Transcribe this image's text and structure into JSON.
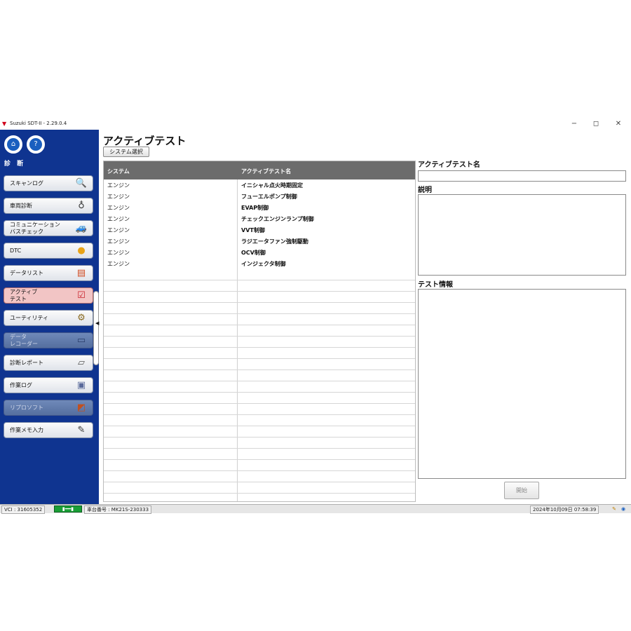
{
  "window": {
    "title": "Suzuki SDT-II - 2.29.0.4",
    "controls": {
      "minimize": "−",
      "restore": "◻",
      "close": "✕"
    }
  },
  "sidebar": {
    "home_icon": "home-icon",
    "help_icon": "help-icon",
    "section_title": "診 断",
    "items": [
      {
        "label": "スキャンログ",
        "icon": "magnifier-icon",
        "glyph": "🔍",
        "state": "normal"
      },
      {
        "label": "車両診断",
        "icon": "stethoscope-icon",
        "glyph": "♁",
        "state": "normal"
      },
      {
        "label": "コミュニケーション\nバスチェック",
        "icon": "car-icon",
        "glyph": "🚙",
        "state": "normal"
      },
      {
        "label": "DTC",
        "icon": "engine-light-icon",
        "glyph": "●",
        "state": "normal"
      },
      {
        "label": "データリスト",
        "icon": "data-book-icon",
        "glyph": "▤",
        "state": "normal"
      },
      {
        "label": "アクティブ\nテスト",
        "icon": "checklist-icon",
        "glyph": "☑",
        "state": "active"
      },
      {
        "label": "ユーティリティ",
        "icon": "gear-icon",
        "glyph": "⚙",
        "state": "normal"
      },
      {
        "label": "データ\nレコーダー",
        "icon": "recorder-icon",
        "glyph": "▭",
        "state": "disabled"
      },
      {
        "label": "診断レポート",
        "icon": "report-icon",
        "glyph": "▱",
        "state": "normal"
      },
      {
        "label": "作業ログ",
        "icon": "log-icon",
        "glyph": "▣",
        "state": "normal"
      },
      {
        "label": "リプロソフト",
        "icon": "reprogram-icon",
        "glyph": "◩",
        "state": "disabled"
      },
      {
        "label": "作業メモ入力",
        "icon": "memo-icon",
        "glyph": "✎",
        "state": "normal"
      }
    ]
  },
  "main": {
    "title": "アクティブテスト",
    "system_select_button": "システム選択",
    "table": {
      "headers": [
        "システム",
        "アクティブテスト名"
      ],
      "rows": [
        [
          "エンジン",
          "イニシャル点火時期固定"
        ],
        [
          "エンジン",
          "フューエルポンプ制御"
        ],
        [
          "エンジン",
          "EVAP制御"
        ],
        [
          "エンジン",
          "チェックエンジンランプ制御"
        ],
        [
          "エンジン",
          "VVT制御"
        ],
        [
          "エンジン",
          "ラジエータファン強制駆動"
        ],
        [
          "エンジン",
          "OCV制御"
        ],
        [
          "エンジン",
          "インジェクタ制御"
        ]
      ],
      "empty_rows": 20
    }
  },
  "right_panel": {
    "test_name_label": "アクティブテスト名",
    "test_name_value": "",
    "description_label": "説明",
    "test_info_label": "テスト情報",
    "start_button": "開始"
  },
  "status_bar": {
    "vci": "VCI : 31605352",
    "vehicle_number": "車台番号 : MK21S-230333",
    "datetime": "2024年10月09日 07:58:39"
  }
}
